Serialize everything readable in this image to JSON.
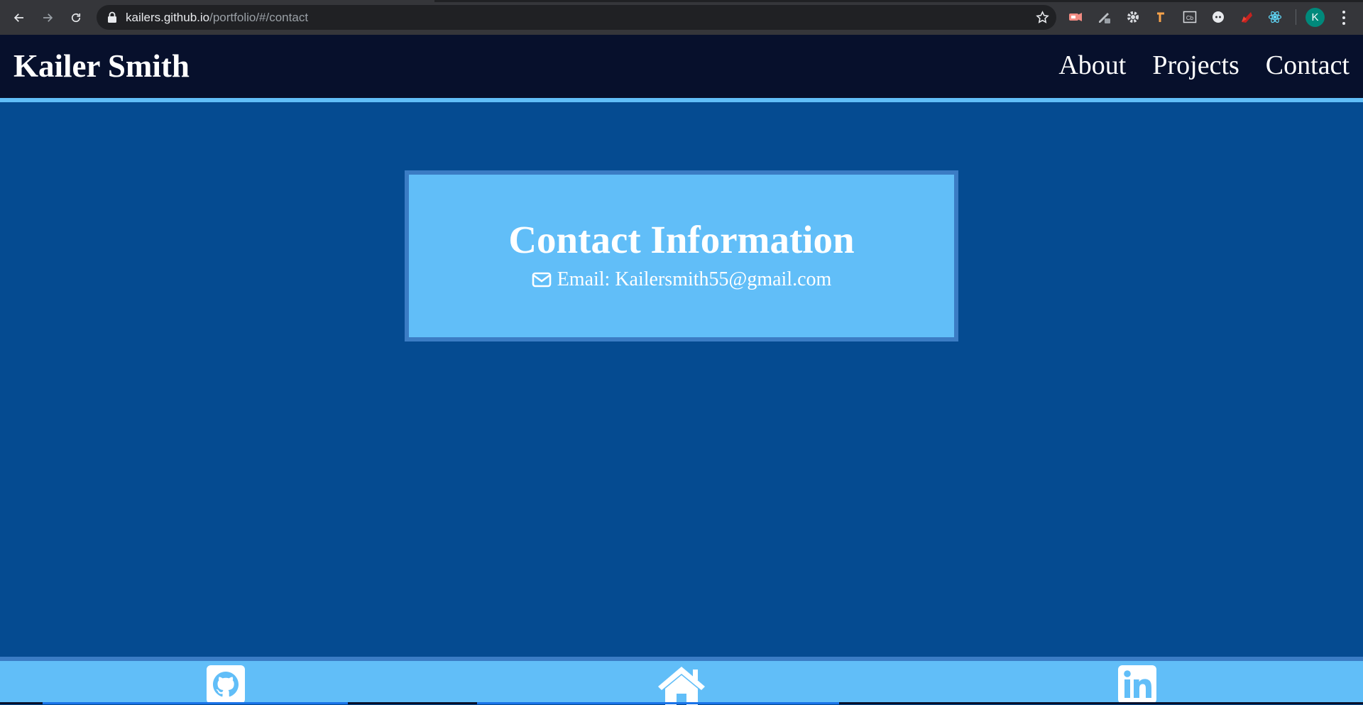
{
  "browser": {
    "url_host": "kailers.github.io",
    "url_path": "/portfolio/#/contact",
    "profile_initial": "K",
    "extensions": [
      "video-extension-icon",
      "pen-extension-icon",
      "gear-extension-icon",
      "pickaxe-extension-icon",
      "cb-extension-icon",
      "circle-extension-icon",
      "ruby-extension-icon",
      "react-devtools-icon"
    ],
    "cb_label": "Cb"
  },
  "header": {
    "brand": "Kailer Smith",
    "nav": [
      {
        "label": "About"
      },
      {
        "label": "Projects"
      },
      {
        "label": "Contact"
      }
    ]
  },
  "contact": {
    "title": "Contact Information",
    "email_label": "Email: Kailersmith55@gmail.com"
  },
  "footer": {
    "links": [
      "github-icon",
      "home-icon",
      "linkedin-icon"
    ]
  },
  "colors": {
    "page_bg": "#054b91",
    "header_bg": "#07102c",
    "accent": "#61bef8",
    "card_border": "#3b7cc4",
    "text": "#ffffff"
  }
}
